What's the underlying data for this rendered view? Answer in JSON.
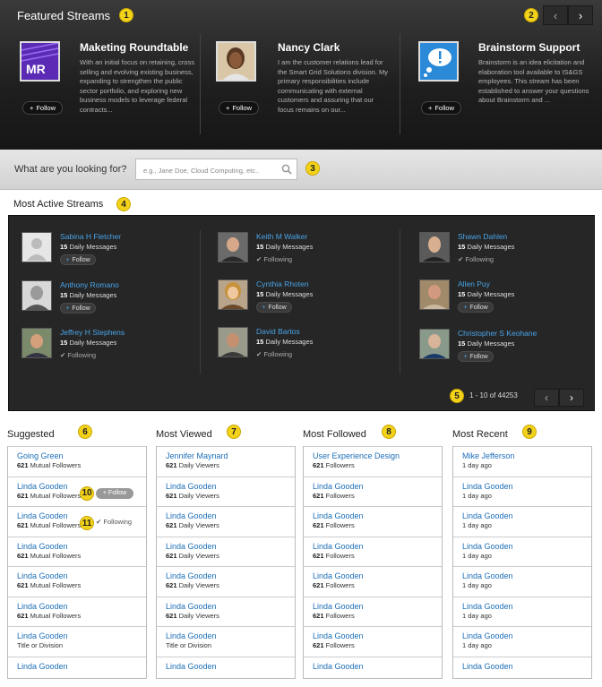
{
  "featured": {
    "title": "Featured Streams",
    "badges": [
      "1",
      "2"
    ],
    "cards": [
      {
        "name": "Maketing Roundtable",
        "desc": "With an initial focus on retaining, cross selling and evolving existing business, expanding to strengthen the public sector portfolio, and exploring new business models to leverage federal contracts...",
        "follow": "Follow",
        "logo_text": "MR"
      },
      {
        "name": "Nancy Clark",
        "desc": "I am the customer relations lead for the Smart Grid Solutions division. My primary responsibilities include communicating with external customers and assuring that our focus remains on our...",
        "follow": "Follow"
      },
      {
        "name": "Brainstorm Support",
        "desc": "Brainstorm is an idea elicitation and elaboration tool available to IS&GS employees.  This stream has been established to answer your questions about Brainstorm and ...",
        "follow": "Follow"
      }
    ]
  },
  "search": {
    "question": "What are you looking for?",
    "placeholder": "e.g., Jane Doe, Cloud Computing, etc..",
    "badge": "3"
  },
  "active": {
    "title": "Most Active Streams",
    "badge": "4",
    "people": [
      {
        "name": "Sabina H Fletcher",
        "count": "15",
        "msg": "Daily Messages",
        "state": "Follow"
      },
      {
        "name": "Anthony Romano",
        "count": "15",
        "msg": "Daily Messages",
        "state": "Follow"
      },
      {
        "name": "Jeffrey H Stephens",
        "count": "15",
        "msg": "Daily Messages",
        "state": "Following"
      },
      {
        "name": "Keith M Walker",
        "count": "15",
        "msg": "Daily Messages",
        "state": "Following"
      },
      {
        "name": "Cynthia Rhoten",
        "count": "15",
        "msg": "Daily Messages",
        "state": "Follow"
      },
      {
        "name": "David Bartos",
        "count": "15",
        "msg": "Daily Messages",
        "state": "Following"
      },
      {
        "name": "Shawn Dahlen",
        "count": "15",
        "msg": "Daily Messages",
        "state": "Following"
      },
      {
        "name": "Allen Puy",
        "count": "15",
        "msg": "Daily Messages",
        "state": "Follow"
      },
      {
        "name": "Christopher S Keohane",
        "count": "15",
        "msg": "Daily Messages",
        "state": "Follow"
      }
    ],
    "pager": "1 - 10 of 44253",
    "pager_badge": "5"
  },
  "columns": [
    {
      "title": "Suggested",
      "badge": "6",
      "items": [
        {
          "name": "Going Green",
          "count": "621",
          "label": "Mutual Followers"
        },
        {
          "name": "Linda Gooden",
          "count": "621",
          "label": "Mutual Followers",
          "extra": "Follow",
          "extra_badge": "10"
        },
        {
          "name": "Linda Gooden",
          "count": "621",
          "label": "Mutual Followers",
          "extra": "Following",
          "extra_badge": "11"
        },
        {
          "name": "Linda Gooden",
          "count": "621",
          "label": "Mutual Followers"
        },
        {
          "name": "Linda Gooden",
          "count": "621",
          "label": "Mutual Followers"
        },
        {
          "name": "Linda Gooden",
          "count": "621",
          "label": "Mutual Followers"
        },
        {
          "name": "Linda Gooden",
          "count": "",
          "label": "Title or Division"
        },
        {
          "name": "Linda Gooden",
          "count": "",
          "label": ""
        }
      ]
    },
    {
      "title": "Most Viewed",
      "badge": "7",
      "items": [
        {
          "name": "Jennifer Maynard",
          "count": "621",
          "label": "Daily Viewers"
        },
        {
          "name": "Linda Gooden",
          "count": "621",
          "label": "Daily Viewers"
        },
        {
          "name": "Linda Gooden",
          "count": "621",
          "label": "Daily Viewers"
        },
        {
          "name": "Linda Gooden",
          "count": "621",
          "label": "Daily Viewers"
        },
        {
          "name": "Linda Gooden",
          "count": "621",
          "label": "Daily Viewers"
        },
        {
          "name": "Linda Gooden",
          "count": "621",
          "label": "Daily Viewers"
        },
        {
          "name": "Linda Gooden",
          "count": "",
          "label": "Title or Division"
        },
        {
          "name": "Linda Gooden",
          "count": "",
          "label": ""
        }
      ]
    },
    {
      "title": "Most Followed",
      "badge": "8",
      "items": [
        {
          "name": "User Experience Design",
          "count": "621",
          "label": "Followers"
        },
        {
          "name": "Linda Gooden",
          "count": "621",
          "label": "Followers"
        },
        {
          "name": "Linda Gooden",
          "count": "621",
          "label": "Followers"
        },
        {
          "name": "Linda Gooden",
          "count": "621",
          "label": "Followers"
        },
        {
          "name": "Linda Gooden",
          "count": "621",
          "label": "Followers"
        },
        {
          "name": "Linda Gooden",
          "count": "621",
          "label": "Followers"
        },
        {
          "name": "Linda Gooden",
          "count": "621",
          "label": "Followers"
        },
        {
          "name": "Linda Gooden",
          "count": "",
          "label": ""
        }
      ]
    },
    {
      "title": "Most Recent",
      "badge": "9",
      "items": [
        {
          "name": "Mike Jefferson",
          "count": "",
          "label": "1 day ago"
        },
        {
          "name": "Linda Gooden",
          "count": "",
          "label": "1 day ago"
        },
        {
          "name": "Linda Gooden",
          "count": "",
          "label": "1 day ago"
        },
        {
          "name": "Linda Gooden",
          "count": "",
          "label": "1 day ago"
        },
        {
          "name": "Linda Gooden",
          "count": "",
          "label": "1 day ago"
        },
        {
          "name": "Linda Gooden",
          "count": "",
          "label": "1 day ago"
        },
        {
          "name": "Linda Gooden",
          "count": "",
          "label": "1 day ago"
        },
        {
          "name": "Linda Gooden",
          "count": "",
          "label": ""
        }
      ]
    }
  ]
}
